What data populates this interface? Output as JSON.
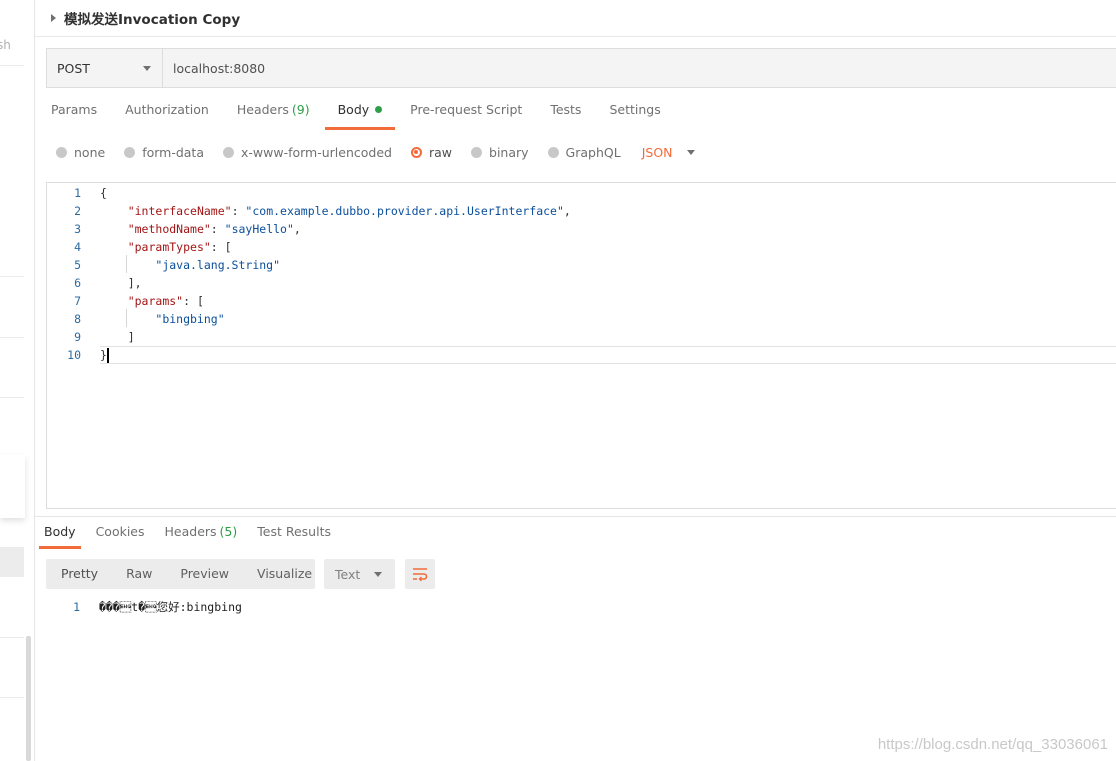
{
  "sidebar": {
    "fragment_text": "sh"
  },
  "request": {
    "title": "模拟发送Invocation Copy",
    "method": "POST",
    "url": "localhost:8080"
  },
  "request_tabs": {
    "params": "Params",
    "authorization": "Authorization",
    "headers": "Headers",
    "headers_count": "(9)",
    "body": "Body",
    "prerequest": "Pre-request Script",
    "tests": "Tests",
    "settings": "Settings"
  },
  "body_types": {
    "none": "none",
    "form_data": "form-data",
    "urlencoded": "x-www-form-urlencoded",
    "raw": "raw",
    "binary": "binary",
    "graphql": "GraphQL",
    "language": "JSON",
    "selected": "raw"
  },
  "editor": {
    "lines": [
      {
        "n": "1",
        "parts": [
          [
            "p",
            "{"
          ]
        ]
      },
      {
        "n": "2",
        "parts": [
          [
            "p",
            "    "
          ],
          [
            "k",
            "\"interfaceName\""
          ],
          [
            "p",
            ": "
          ],
          [
            "s",
            "\"com.example.dubbo.provider.api.UserInterface\""
          ],
          [
            "p",
            ","
          ]
        ]
      },
      {
        "n": "3",
        "parts": [
          [
            "p",
            "    "
          ],
          [
            "k",
            "\"methodName\""
          ],
          [
            "p",
            ": "
          ],
          [
            "s",
            "\"sayHello\""
          ],
          [
            "p",
            ","
          ]
        ]
      },
      {
        "n": "4",
        "parts": [
          [
            "p",
            "    "
          ],
          [
            "k",
            "\"paramTypes\""
          ],
          [
            "p",
            ": ["
          ]
        ]
      },
      {
        "n": "5",
        "parts": [
          [
            "p",
            "        "
          ],
          [
            "s",
            "\"java.lang.String\""
          ]
        ]
      },
      {
        "n": "6",
        "parts": [
          [
            "p",
            "    ],"
          ]
        ]
      },
      {
        "n": "7",
        "parts": [
          [
            "p",
            "    "
          ],
          [
            "k",
            "\"params\""
          ],
          [
            "p",
            ": ["
          ]
        ]
      },
      {
        "n": "8",
        "parts": [
          [
            "p",
            "        "
          ],
          [
            "s",
            "\"bingbing\""
          ]
        ]
      },
      {
        "n": "9",
        "parts": [
          [
            "p",
            "    ]"
          ]
        ]
      },
      {
        "n": "10",
        "parts": [
          [
            "p",
            "}"
          ]
        ]
      }
    ]
  },
  "response_tabs": {
    "body": "Body",
    "cookies": "Cookies",
    "headers": "Headers",
    "headers_count": "(5)",
    "test_results": "Test Results"
  },
  "response_view": {
    "pretty": "Pretty",
    "raw": "Raw",
    "preview": "Preview",
    "visualize": "Visualize",
    "format": "Text"
  },
  "response_body": {
    "line_number": "1",
    "text": "���\u0005t�\u0005您好:bingbing"
  },
  "watermark": "https://blog.csdn.net/qq_33036061",
  "colors": {
    "accent": "#f26b3a",
    "count_green": "#2e9e48",
    "json_key": "#a31515",
    "json_string": "#0b4f9c"
  }
}
